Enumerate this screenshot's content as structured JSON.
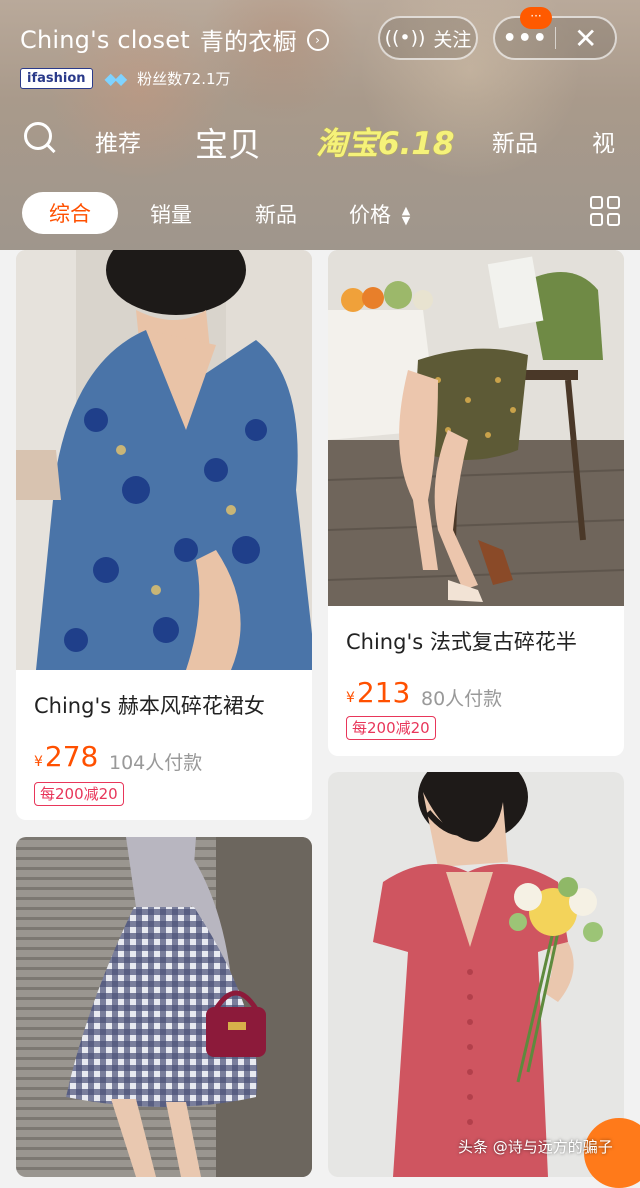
{
  "header": {
    "shop_name_en": "Ching's closet",
    "shop_name_cn": "青的衣橱",
    "brand_tag": "ifashion",
    "fans_label": "粉丝数72.1万",
    "follow_label": "关注",
    "more_label": "•••",
    "badge_label": "···",
    "close_label": "✕"
  },
  "nav": {
    "items": [
      "推荐",
      "宝贝",
      "淘宝6.18",
      "新品",
      "视"
    ]
  },
  "sort": {
    "items": [
      "综合",
      "销量",
      "新品",
      "价格"
    ],
    "active": "综合"
  },
  "products": [
    {
      "name": "Ching's 赫本风碎花裙女",
      "price": "278",
      "sales": "104人付款",
      "promo": "每200减20"
    },
    {
      "name": "Ching's 法式复古碎花半",
      "price": "213",
      "sales": "80人付款",
      "promo": "每200减20"
    }
  ],
  "currency": "¥",
  "watermark": "头条 @诗与远方的骗子",
  "colors": {
    "accent": "#ff5000",
    "promo": "#e8365a",
    "taobao_yellow": "#f5f27a"
  }
}
